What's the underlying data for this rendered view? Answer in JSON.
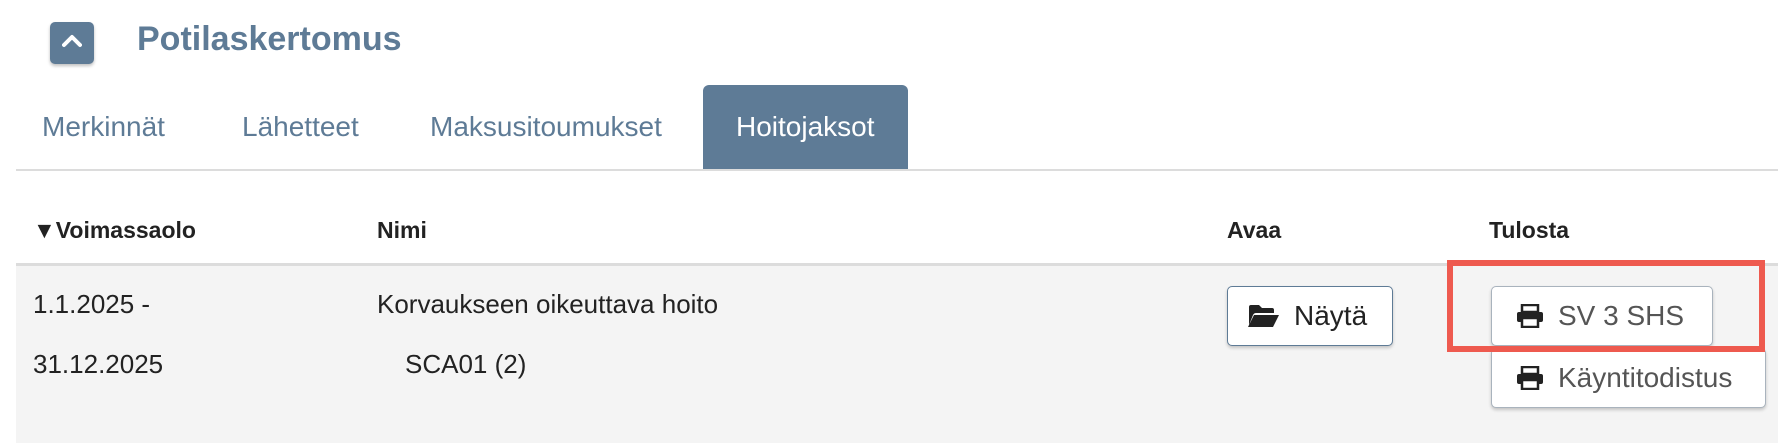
{
  "header": {
    "title": "Potilaskertomus",
    "collapse_icon": "chevron-up-icon"
  },
  "tabs": [
    {
      "label": "Merkinnät",
      "active": false
    },
    {
      "label": "Lähetteet",
      "active": false
    },
    {
      "label": "Maksusitoumukset",
      "active": false
    },
    {
      "label": "Hoitojaksot",
      "active": true
    }
  ],
  "table": {
    "columns": {
      "sort_indicator": "▼",
      "validity": "Voimassaolo",
      "name": "Nimi",
      "open": "Avaa",
      "print": "Tulosta"
    },
    "rows": [
      {
        "validity_start": "1.1.2025 -",
        "validity_end": "31.12.2025",
        "name": "Korvaukseen oikeuttava hoito",
        "code": "SCA01 (2)",
        "open_button": {
          "label": "Näytä",
          "icon": "folder-open-icon"
        },
        "print_buttons": [
          {
            "label": "SV 3 SHS",
            "icon": "printer-icon",
            "highlighted": true
          },
          {
            "label": "Käyntitodistus",
            "icon": "printer-icon",
            "highlighted": false
          }
        ]
      }
    ]
  },
  "colors": {
    "accent": "#5e7b96",
    "highlight": "#ee5a4f",
    "row_background": "#f4f4f4"
  }
}
